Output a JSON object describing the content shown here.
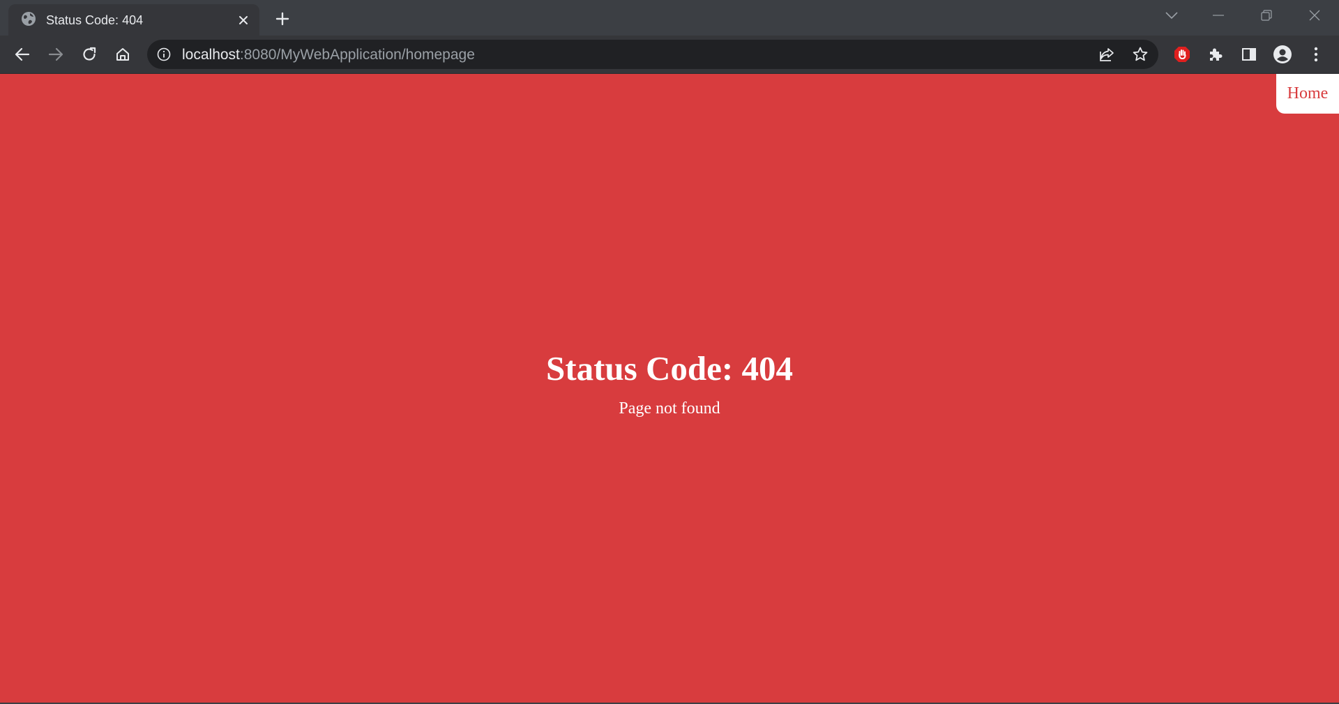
{
  "browser": {
    "tab": {
      "title": "Status Code: 404"
    },
    "address_bar": {
      "host": "localhost",
      "path": ":8080/MyWebApplication/homepage"
    },
    "colors": {
      "tab_strip": "#3c3f44",
      "toolbar": "#35363a",
      "omnibox": "#202124",
      "extension_badge": "#e0201f"
    }
  },
  "page": {
    "nav": {
      "home_label": "Home"
    },
    "error": {
      "title": "Status Code: 404",
      "message": "Page not found"
    },
    "colors": {
      "background": "#d83c3e",
      "text": "#ffffff"
    }
  }
}
